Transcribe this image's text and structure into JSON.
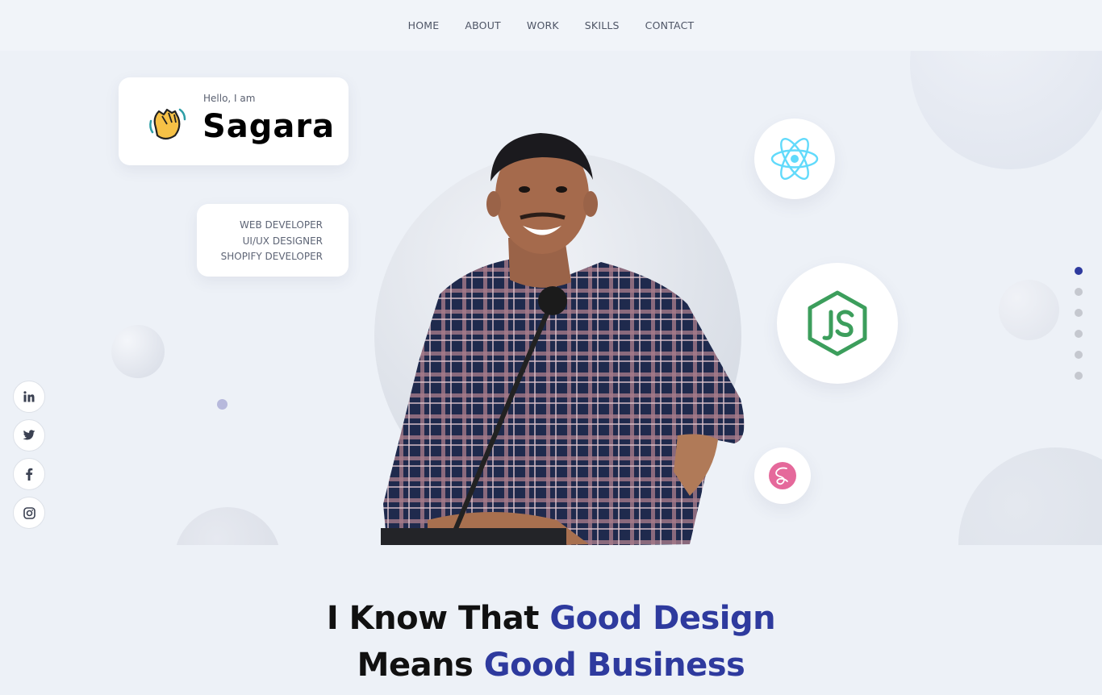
{
  "nav": {
    "items": [
      "HOME",
      "ABOUT",
      "WORK",
      "SKILLS",
      "CONTACT"
    ]
  },
  "hero": {
    "greeting": "Hello, I am",
    "name": "Sagara",
    "roles": [
      "WEB DEVELOPER",
      "UI/UX DESIGNER",
      "SHOPIFY DEVELOPER"
    ],
    "tech_icons": [
      "react-icon",
      "nodejs-icon",
      "sass-icon"
    ]
  },
  "section_dots": {
    "count": 6,
    "active_index": 0
  },
  "socials": [
    "linkedin-icon",
    "twitter-icon",
    "facebook-icon",
    "instagram-icon"
  ],
  "tagline": {
    "line1_plain": "I Know That",
    "line1_highlight": "Good Design",
    "line2_plain": "Means",
    "line2_highlight": "Good Business"
  },
  "colors": {
    "accent": "#2e3a9e",
    "background": "#edf1f7",
    "react": "#61dafb",
    "node": "#3c9e5c",
    "sass": "#e5699b"
  }
}
